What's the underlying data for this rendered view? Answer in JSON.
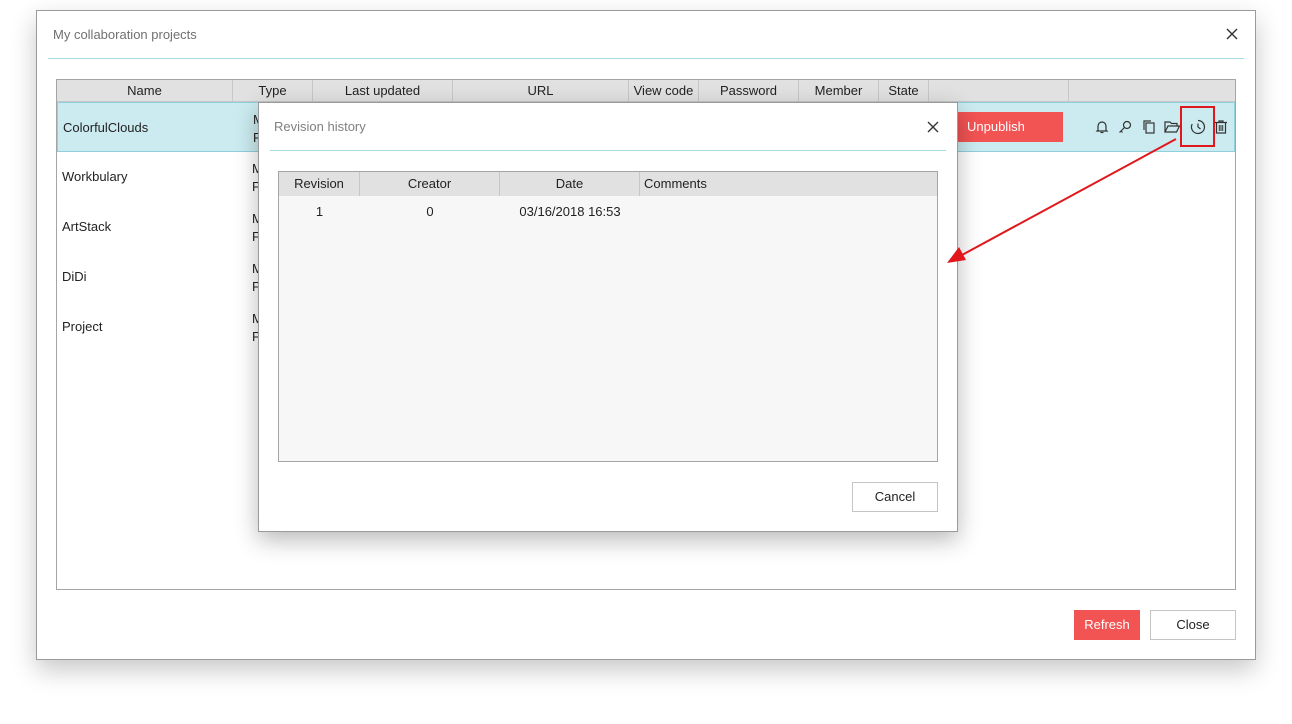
{
  "main_dialog": {
    "title": "My collaboration projects",
    "close_icon": "close-icon"
  },
  "projects_table": {
    "columns": [
      "Name",
      "Type",
      "Last updated",
      "URL",
      "View code",
      "Password",
      "Member",
      "State",
      ""
    ],
    "rows": [
      {
        "name": "ColorfulClouds",
        "type_line1": "M",
        "type_line2": "P",
        "selected": true
      },
      {
        "name": "Workbulary",
        "type_line1": "M",
        "type_line2": "P",
        "selected": false
      },
      {
        "name": "ArtStack",
        "type_line1": "M",
        "type_line2": "P",
        "selected": false
      },
      {
        "name": "DiDi",
        "type_line1": "M",
        "type_line2": "P",
        "selected": false
      },
      {
        "name": "Project",
        "type_line1": "M",
        "type_line2": "P",
        "selected": false
      }
    ],
    "selected_row_actions": {
      "unpublish_label": "Unpublish",
      "icons": [
        "bell-icon",
        "key-icon",
        "copy-icon",
        "folder-open-icon",
        "history-icon",
        "trash-icon"
      ]
    }
  },
  "revision_dialog": {
    "title": "Revision history",
    "columns": [
      "Revision",
      "Creator",
      "Date",
      "Comments"
    ],
    "rows": [
      {
        "revision": "1",
        "creator": "0",
        "date": "03/16/2018 16:53",
        "comments": ""
      }
    ],
    "cancel_label": "Cancel"
  },
  "footer": {
    "refresh_label": "Refresh",
    "close_label": "Close"
  },
  "colors": {
    "accent_red": "#f25353",
    "selected_row": "#cbebf0",
    "divider": "#a8dde6",
    "annotation_red": "#e0181b"
  }
}
